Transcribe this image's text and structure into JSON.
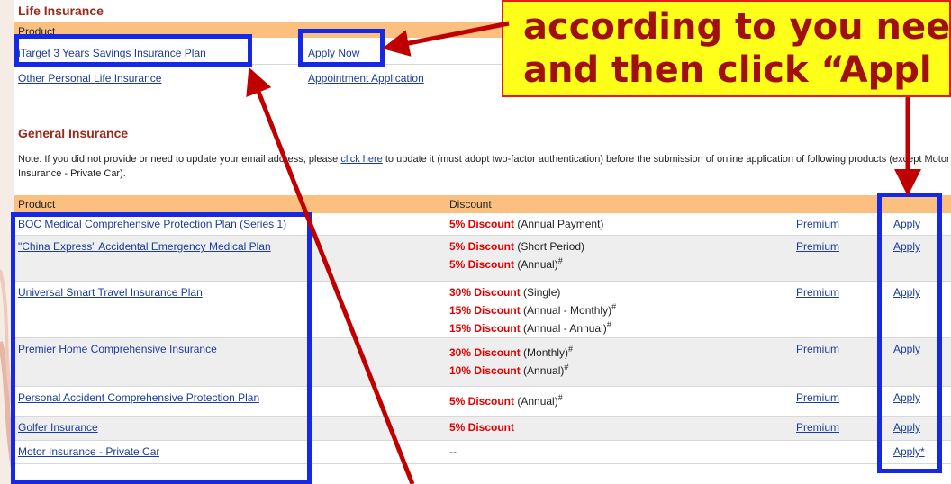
{
  "life": {
    "title": "Life Insurance",
    "header": {
      "product": "Product"
    },
    "rows": [
      {
        "product": "iTarget 3 Years Savings Insurance Plan",
        "action": "Apply Now"
      },
      {
        "product": "Other Personal Life Insurance",
        "action": "Appointment Application"
      }
    ]
  },
  "general": {
    "title": "General Insurance",
    "note": {
      "before": "Note: If you did not provide or need to update your email address, please ",
      "link": "click here",
      "after": " to update it (must adopt two-factor authentication) before the submission of online application of following products (except Motor Insurance - Private Car)."
    },
    "header": {
      "product": "Product",
      "discount": "Discount"
    },
    "premium_label": "Premium",
    "rows": [
      {
        "product": "BOC Medical Comprehensive Protection Plan (Series 1)",
        "apply": "Apply",
        "discounts": [
          {
            "red": "5% Discount",
            "detail": " (Annual Payment)",
            "sup": ""
          }
        ]
      },
      {
        "product": "\"China Express\" Accidental Emergency Medical Plan",
        "apply": "Apply",
        "discounts": [
          {
            "red": "5% Discount",
            "detail": " (Short Period)",
            "sup": ""
          },
          {
            "red": "5% Discount",
            "detail": " (Annual)",
            "sup": "#"
          }
        ]
      },
      {
        "product": "Universal Smart Travel Insurance Plan",
        "apply": "Apply",
        "discounts": [
          {
            "red": "30% Discount",
            "detail": " (Single)",
            "sup": ""
          },
          {
            "red": "15% Discount",
            "detail": " (Annual - Monthly)",
            "sup": "#"
          },
          {
            "red": "15% Discount",
            "detail": " (Annual - Annual)",
            "sup": "#"
          }
        ]
      },
      {
        "product": "Premier Home Comprehensive Insurance",
        "apply": "Apply",
        "discounts": [
          {
            "red": "30% Discount",
            "detail": " (Monthly)",
            "sup": "#"
          },
          {
            "red": "10% Discount",
            "detail": " (Annual)",
            "sup": "#"
          }
        ]
      },
      {
        "product": "Personal Accident Comprehensive Protection Plan",
        "apply": "Apply",
        "discounts": [
          {
            "red": "5% Discount",
            "detail": " (Annual)",
            "sup": "#"
          }
        ]
      },
      {
        "product": "Golfer Insurance",
        "apply": "Apply",
        "discounts": [
          {
            "red": "5% Discount",
            "detail": "",
            "sup": ""
          }
        ]
      },
      {
        "product": "Motor Insurance - Private Car",
        "apply": "Apply*",
        "discounts": [],
        "discount_text": "--",
        "no_premium": true
      }
    ]
  },
  "callout": {
    "line1": "according to you nee",
    "line2": "and then click “Appl"
  },
  "colors": {
    "header_band": "#fbc07f",
    "highlight_box": "#1428e6",
    "arrow": "#c00000",
    "callout_fill": "#ffff19",
    "link": "#1a3c9e",
    "discount_red": "#e00000"
  }
}
